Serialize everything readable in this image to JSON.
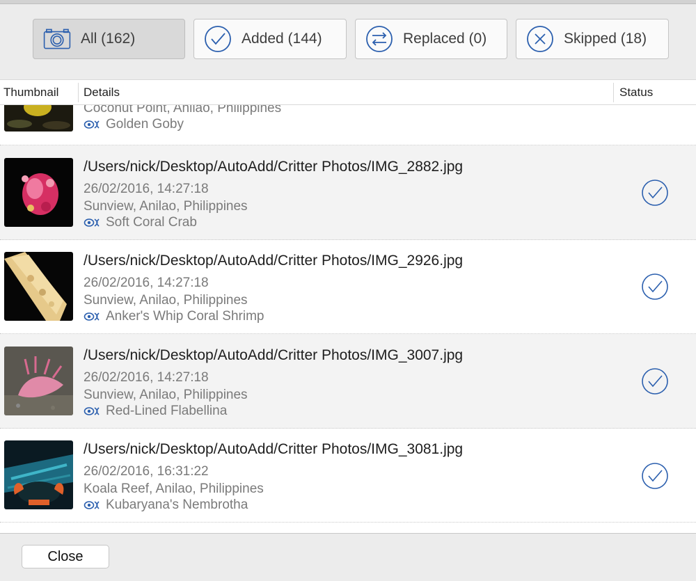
{
  "filters": [
    {
      "label": "All (162)",
      "icon": "camera-icon",
      "active": true
    },
    {
      "label": "Added (144)",
      "icon": "checkmark-circle-icon",
      "active": false
    },
    {
      "label": "Replaced (0)",
      "icon": "swap-arrows-icon",
      "active": false
    },
    {
      "label": "Skipped (18)",
      "icon": "x-circle-icon",
      "active": false
    }
  ],
  "columns": {
    "thumbnail": "Thumbnail",
    "details": "Details",
    "status": "Status"
  },
  "rows": [
    {
      "path": "",
      "date": "",
      "location": "Coconut Point, Anilao, Philippines",
      "species": "Golden Goby",
      "status": "added"
    },
    {
      "path": "/Users/nick/Desktop/AutoAdd/Critter Photos/IMG_2882.jpg",
      "date": "26/02/2016, 14:27:18",
      "location": "Sunview, Anilao, Philippines",
      "species": "Soft Coral Crab",
      "status": "added"
    },
    {
      "path": "/Users/nick/Desktop/AutoAdd/Critter Photos/IMG_2926.jpg",
      "date": "26/02/2016, 14:27:18",
      "location": "Sunview, Anilao, Philippines",
      "species": "Anker's Whip Coral Shrimp",
      "status": "added"
    },
    {
      "path": "/Users/nick/Desktop/AutoAdd/Critter Photos/IMG_3007.jpg",
      "date": "26/02/2016, 14:27:18",
      "location": "Sunview, Anilao, Philippines",
      "species": "Red-Lined Flabellina",
      "status": "added"
    },
    {
      "path": "/Users/nick/Desktop/AutoAdd/Critter Photos/IMG_3081.jpg",
      "date": "26/02/2016, 16:31:22",
      "location": "Koala Reef, Anilao, Philippines",
      "species": "Kubaryana's Nembrotha",
      "status": "added"
    }
  ],
  "footer": {
    "close_label": "Close"
  },
  "colors": {
    "accent": "#2b5fae",
    "icon_gray": "#3a3a3a"
  }
}
